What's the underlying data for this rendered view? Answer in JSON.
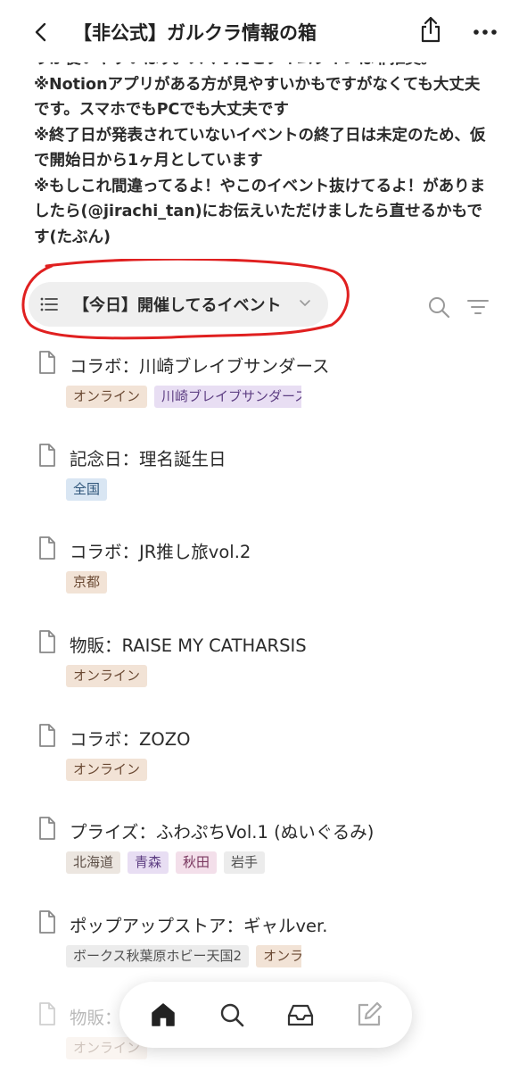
{
  "header": {
    "title": "【非公式】ガルクラ情報の箱",
    "back_icon": "chevron-left-icon",
    "share_icon": "share-icon",
    "more_icon": "more-horizontal-icon"
  },
  "notes": [
    "りが使いやすいはず。スマホだとタイムラインは非推奨。",
    "※Notionアプリがある方が見やすいかもですがなくても大丈夫",
    "です。スマホでもPCでも大丈夫です",
    "※終了日が発表されていないイベントの終了日は未定のため、仮",
    "で開始日から1ヶ月としています",
    "※もしこれ間違ってるよ！やこのイベント抜けてるよ！がありま",
    "したら(@jirachi_tan)にお伝えいただけましたら直せるかもで",
    "す(たぶん)"
  ],
  "view": {
    "label": "【今日】開催してるイベント",
    "icon": "list-icon",
    "annotation_color": "#e02020"
  },
  "items": [
    {
      "title": "コラボ：川崎ブレイブサンダース",
      "tags": [
        {
          "label": "オンライン",
          "bg": "#f2e3d6",
          "fg": "#6b4a34"
        },
        {
          "label": "川崎ブレイブサンダース",
          "bg": "#e8def3",
          "fg": "#5e3f83"
        }
      ]
    },
    {
      "title": "記念日：理名誕生日",
      "tags": [
        {
          "label": "全国",
          "bg": "#d9e6f3",
          "fg": "#2d5479"
        }
      ]
    },
    {
      "title": "コラボ：JR推し旅vol.2",
      "tags": [
        {
          "label": "京都",
          "bg": "#f2e3d6",
          "fg": "#6b4a34"
        }
      ]
    },
    {
      "title": "物販：RAISE MY CATHARSIS",
      "tags": [
        {
          "label": "オンライン",
          "bg": "#f2e3d6",
          "fg": "#6b4a34"
        }
      ]
    },
    {
      "title": "コラボ：ZOZO",
      "tags": [
        {
          "label": "オンライン",
          "bg": "#f2e3d6",
          "fg": "#6b4a34"
        }
      ]
    },
    {
      "title": "プライズ：ふわぷちVol.1 (ぬいぐるみ)",
      "tags": [
        {
          "label": "北海道",
          "bg": "#ece6e0",
          "fg": "#5e5047"
        },
        {
          "label": "青森",
          "bg": "#e8def3",
          "fg": "#5e3f83"
        },
        {
          "label": "秋田",
          "bg": "#f3dfea",
          "fg": "#7a3860"
        },
        {
          "label": "岩手",
          "bg": "#ececec",
          "fg": "#505050"
        }
      ]
    },
    {
      "title": "ポップアップストア：ギャルver.",
      "tags": [
        {
          "label": "ボークス秋葉原ホビー天国2",
          "bg": "#ececec",
          "fg": "#505050"
        },
        {
          "label": "オンライン",
          "bg": "#f2e3d6",
          "fg": "#6b4a34"
        }
      ]
    },
    {
      "title": "物販：",
      "tags": [
        {
          "label": "オンライン",
          "bg": "#f2e3d6",
          "fg": "#6b4a34"
        }
      ]
    }
  ],
  "nav": {
    "home_icon": "home-icon",
    "search_icon": "search-icon",
    "inbox_icon": "inbox-icon",
    "compose_icon": "compose-icon"
  }
}
